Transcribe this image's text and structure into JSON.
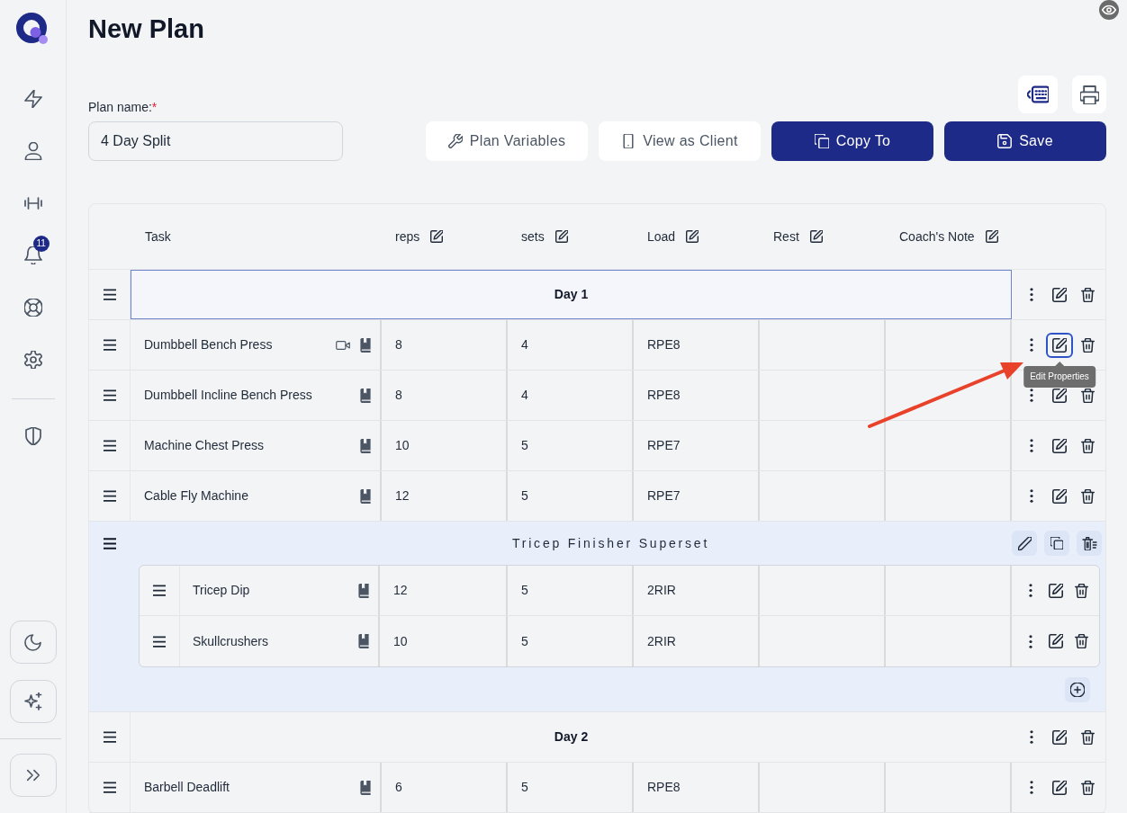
{
  "sidebar": {
    "notification_badge": "11"
  },
  "page": {
    "title": "New Plan"
  },
  "plan_name": {
    "label": "Plan name:",
    "required_mark": "*",
    "value": "4 Day Split"
  },
  "toolbar": {
    "buttons": [
      {
        "label": "Plan Variables",
        "kind": "secondary"
      },
      {
        "label": "View as Client",
        "kind": "secondary"
      },
      {
        "label": "Copy To",
        "kind": "primary"
      },
      {
        "label": "Save",
        "kind": "primary"
      }
    ]
  },
  "table": {
    "columns": [
      {
        "label": "Task",
        "editable": false
      },
      {
        "label": "reps",
        "editable": true
      },
      {
        "label": "sets",
        "editable": true
      },
      {
        "label": "Load",
        "editable": true
      },
      {
        "label": "Rest",
        "editable": true
      },
      {
        "label": "Coach's Note",
        "editable": true
      }
    ],
    "rows": [
      {
        "kind": "day",
        "label": "Day 1",
        "selected": true,
        "edit_focused": false
      },
      {
        "kind": "exercise",
        "task": "Dumbbell Bench Press",
        "reps": "8",
        "sets": "4",
        "load": "RPE8",
        "video": true,
        "edit_focused": true
      },
      {
        "kind": "exercise",
        "task": "Dumbbell Incline Bench Press",
        "reps": "8",
        "sets": "4",
        "load": "RPE8",
        "video": false,
        "edit_focused": false
      },
      {
        "kind": "exercise",
        "task": "Machine Chest Press",
        "reps": "10",
        "sets": "5",
        "load": "RPE7",
        "video": false,
        "edit_focused": false
      },
      {
        "kind": "exercise",
        "task": "Cable Fly Machine",
        "reps": "12",
        "sets": "5",
        "load": "RPE7",
        "video": false,
        "edit_focused": false
      },
      {
        "kind": "superset",
        "title": "Tricep Finisher Superset",
        "rows": [
          {
            "kind": "exercise",
            "task": "Tricep Dip",
            "reps": "12",
            "sets": "5",
            "load": "2RIR",
            "video": false,
            "edit_focused": false
          },
          {
            "kind": "exercise",
            "task": "Skullcrushers",
            "reps": "10",
            "sets": "5",
            "load": "2RIR",
            "video": false,
            "edit_focused": false
          }
        ]
      },
      {
        "kind": "day",
        "label": "Day 2",
        "selected": false,
        "edit_focused": false
      },
      {
        "kind": "exercise",
        "task": "Barbell Deadlift",
        "reps": "6",
        "sets": "5",
        "load": "RPE8",
        "video": false,
        "edit_focused": false
      }
    ]
  },
  "tooltip": {
    "text": "Edit Properties"
  }
}
